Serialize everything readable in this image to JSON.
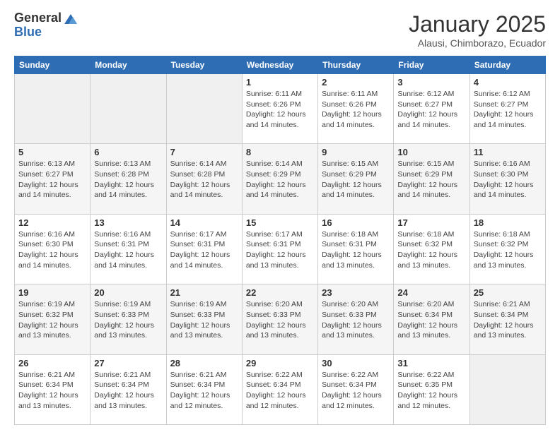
{
  "header": {
    "logo_general": "General",
    "logo_blue": "Blue",
    "month_title": "January 2025",
    "subtitle": "Alausi, Chimborazo, Ecuador"
  },
  "weekdays": [
    "Sunday",
    "Monday",
    "Tuesday",
    "Wednesday",
    "Thursday",
    "Friday",
    "Saturday"
  ],
  "weeks": [
    [
      {
        "day": "",
        "info": ""
      },
      {
        "day": "",
        "info": ""
      },
      {
        "day": "",
        "info": ""
      },
      {
        "day": "1",
        "info": "Sunrise: 6:11 AM\nSunset: 6:26 PM\nDaylight: 12 hours and 14 minutes."
      },
      {
        "day": "2",
        "info": "Sunrise: 6:11 AM\nSunset: 6:26 PM\nDaylight: 12 hours and 14 minutes."
      },
      {
        "day": "3",
        "info": "Sunrise: 6:12 AM\nSunset: 6:27 PM\nDaylight: 12 hours and 14 minutes."
      },
      {
        "day": "4",
        "info": "Sunrise: 6:12 AM\nSunset: 6:27 PM\nDaylight: 12 hours and 14 minutes."
      }
    ],
    [
      {
        "day": "5",
        "info": "Sunrise: 6:13 AM\nSunset: 6:27 PM\nDaylight: 12 hours and 14 minutes."
      },
      {
        "day": "6",
        "info": "Sunrise: 6:13 AM\nSunset: 6:28 PM\nDaylight: 12 hours and 14 minutes."
      },
      {
        "day": "7",
        "info": "Sunrise: 6:14 AM\nSunset: 6:28 PM\nDaylight: 12 hours and 14 minutes."
      },
      {
        "day": "8",
        "info": "Sunrise: 6:14 AM\nSunset: 6:29 PM\nDaylight: 12 hours and 14 minutes."
      },
      {
        "day": "9",
        "info": "Sunrise: 6:15 AM\nSunset: 6:29 PM\nDaylight: 12 hours and 14 minutes."
      },
      {
        "day": "10",
        "info": "Sunrise: 6:15 AM\nSunset: 6:29 PM\nDaylight: 12 hours and 14 minutes."
      },
      {
        "day": "11",
        "info": "Sunrise: 6:16 AM\nSunset: 6:30 PM\nDaylight: 12 hours and 14 minutes."
      }
    ],
    [
      {
        "day": "12",
        "info": "Sunrise: 6:16 AM\nSunset: 6:30 PM\nDaylight: 12 hours and 14 minutes."
      },
      {
        "day": "13",
        "info": "Sunrise: 6:16 AM\nSunset: 6:31 PM\nDaylight: 12 hours and 14 minutes."
      },
      {
        "day": "14",
        "info": "Sunrise: 6:17 AM\nSunset: 6:31 PM\nDaylight: 12 hours and 14 minutes."
      },
      {
        "day": "15",
        "info": "Sunrise: 6:17 AM\nSunset: 6:31 PM\nDaylight: 12 hours and 13 minutes."
      },
      {
        "day": "16",
        "info": "Sunrise: 6:18 AM\nSunset: 6:31 PM\nDaylight: 12 hours and 13 minutes."
      },
      {
        "day": "17",
        "info": "Sunrise: 6:18 AM\nSunset: 6:32 PM\nDaylight: 12 hours and 13 minutes."
      },
      {
        "day": "18",
        "info": "Sunrise: 6:18 AM\nSunset: 6:32 PM\nDaylight: 12 hours and 13 minutes."
      }
    ],
    [
      {
        "day": "19",
        "info": "Sunrise: 6:19 AM\nSunset: 6:32 PM\nDaylight: 12 hours and 13 minutes."
      },
      {
        "day": "20",
        "info": "Sunrise: 6:19 AM\nSunset: 6:33 PM\nDaylight: 12 hours and 13 minutes."
      },
      {
        "day": "21",
        "info": "Sunrise: 6:19 AM\nSunset: 6:33 PM\nDaylight: 12 hours and 13 minutes."
      },
      {
        "day": "22",
        "info": "Sunrise: 6:20 AM\nSunset: 6:33 PM\nDaylight: 12 hours and 13 minutes."
      },
      {
        "day": "23",
        "info": "Sunrise: 6:20 AM\nSunset: 6:33 PM\nDaylight: 12 hours and 13 minutes."
      },
      {
        "day": "24",
        "info": "Sunrise: 6:20 AM\nSunset: 6:34 PM\nDaylight: 12 hours and 13 minutes."
      },
      {
        "day": "25",
        "info": "Sunrise: 6:21 AM\nSunset: 6:34 PM\nDaylight: 12 hours and 13 minutes."
      }
    ],
    [
      {
        "day": "26",
        "info": "Sunrise: 6:21 AM\nSunset: 6:34 PM\nDaylight: 12 hours and 13 minutes."
      },
      {
        "day": "27",
        "info": "Sunrise: 6:21 AM\nSunset: 6:34 PM\nDaylight: 12 hours and 13 minutes."
      },
      {
        "day": "28",
        "info": "Sunrise: 6:21 AM\nSunset: 6:34 PM\nDaylight: 12 hours and 12 minutes."
      },
      {
        "day": "29",
        "info": "Sunrise: 6:22 AM\nSunset: 6:34 PM\nDaylight: 12 hours and 12 minutes."
      },
      {
        "day": "30",
        "info": "Sunrise: 6:22 AM\nSunset: 6:34 PM\nDaylight: 12 hours and 12 minutes."
      },
      {
        "day": "31",
        "info": "Sunrise: 6:22 AM\nSunset: 6:35 PM\nDaylight: 12 hours and 12 minutes."
      },
      {
        "day": "",
        "info": ""
      }
    ]
  ]
}
